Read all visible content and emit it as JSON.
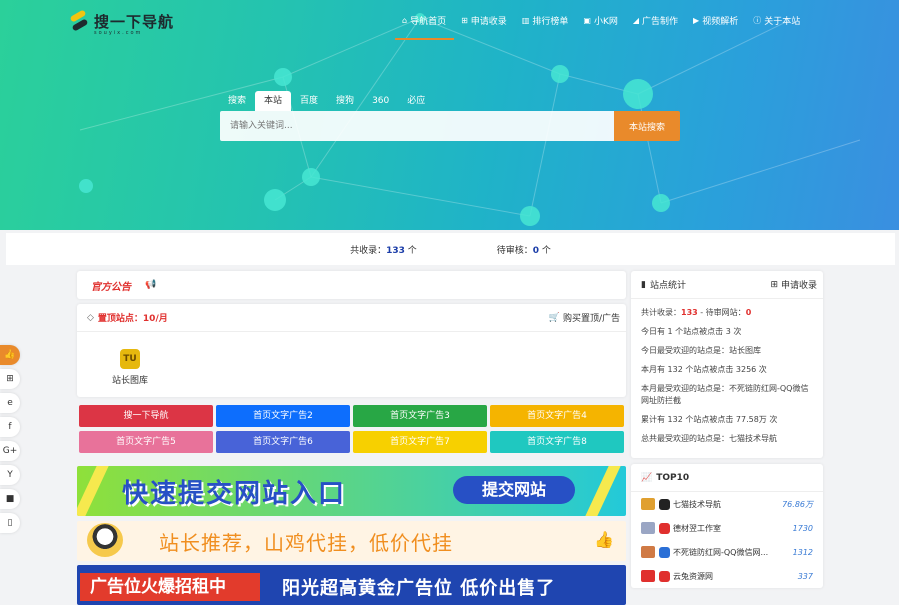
{
  "header": {
    "logo_text": "搜一下导航",
    "logo_sub": "souyix.com",
    "nav": [
      {
        "label": "导航首页",
        "icon": "home-icon",
        "active": true
      },
      {
        "label": "申请收录",
        "icon": "plus-square-icon"
      },
      {
        "label": "排行榜单",
        "icon": "bar-chart-icon"
      },
      {
        "label": "小K网",
        "icon": "play-square-icon"
      },
      {
        "label": "广告制作",
        "icon": "car-icon"
      },
      {
        "label": "视频解析",
        "icon": "video-icon"
      },
      {
        "label": "关于本站",
        "icon": "info-icon"
      }
    ]
  },
  "search": {
    "tabs": [
      "搜索",
      "本站",
      "百度",
      "搜狗",
      "360",
      "必应"
    ],
    "active_tab": "本站",
    "placeholder": "请输入关键词...",
    "button": "本站搜索"
  },
  "stats_bar": {
    "total_label": "共收录：",
    "total_value": "133",
    "total_unit": " 个",
    "pending_label": "待审核：",
    "pending_value": "0",
    "pending_unit": " 个"
  },
  "notice": {
    "title": "官方公告"
  },
  "top_sites": {
    "title": "置顶站点：10/月",
    "buy": "购买置顶/广告",
    "sites": [
      {
        "name": "站长图库",
        "icon_text": "TU"
      }
    ]
  },
  "ad_buttons": [
    {
      "label": "搜一下导航",
      "color": "#dc3545"
    },
    {
      "label": "首页文字广告2",
      "color": "#0d6efd"
    },
    {
      "label": "首页文字广告3",
      "color": "#28a745"
    },
    {
      "label": "首页文字广告4",
      "color": "#f5b400"
    },
    {
      "label": "首页文字广告5",
      "color": "#e8729a"
    },
    {
      "label": "首页文字广告6",
      "color": "#4863d8"
    },
    {
      "label": "首页文字广告7",
      "color": "#f7d000"
    },
    {
      "label": "首页文字广告8",
      "color": "#1fc8c0"
    }
  ],
  "banners": {
    "submit_text": "快速提交网站入口",
    "submit_pill": "提交网站",
    "recommend_text": "站长推荐，山鸡代挂，低价代挂",
    "ad_left": "广告位火爆招租中",
    "ad_right": "阳光超高黄金广告位 低价出售了"
  },
  "site_stats": {
    "title": "站点统计",
    "apply": "申请收录",
    "summary_prefix": "共计收录：",
    "summary_total": "133",
    "summary_mid": " - 待审网站：",
    "summary_pending": "0",
    "lines": [
      "今日有 1 个站点被点击 3 次",
      "今日最受欢迎的站点是：站长图库",
      "本月有 132 个站点被点击 3256 次",
      "本月最受欢迎的站点是：不死链防红网-QQ微信网址防拦截",
      "累计有 132 个站点被点击 77.58万 次",
      "总共最受欢迎的站点是：七猫技术导航"
    ]
  },
  "top10": {
    "title": "TOP10",
    "items": [
      {
        "name": "七猫技术导航",
        "value": "76.86万",
        "medal": "#e0a030",
        "logo": "#222"
      },
      {
        "name": "德材翌工作室",
        "value": "1730",
        "medal": "#9aa6c4",
        "logo": "#e0302e"
      },
      {
        "name": "不死链防红网-QQ微信网...",
        "value": "1312",
        "medal": "#d07a45",
        "logo": "#2a6fd6"
      },
      {
        "name": "云兔资源网",
        "value": "337",
        "medal": "#e0302e",
        "logo": "#e0302e"
      }
    ]
  },
  "side_float": [
    "thumbs-up-icon",
    "windows-icon",
    "edge-icon",
    "facebook-icon",
    "google-plus-icon",
    "yandex-icon",
    "video-camera-icon",
    "mouse-icon"
  ]
}
